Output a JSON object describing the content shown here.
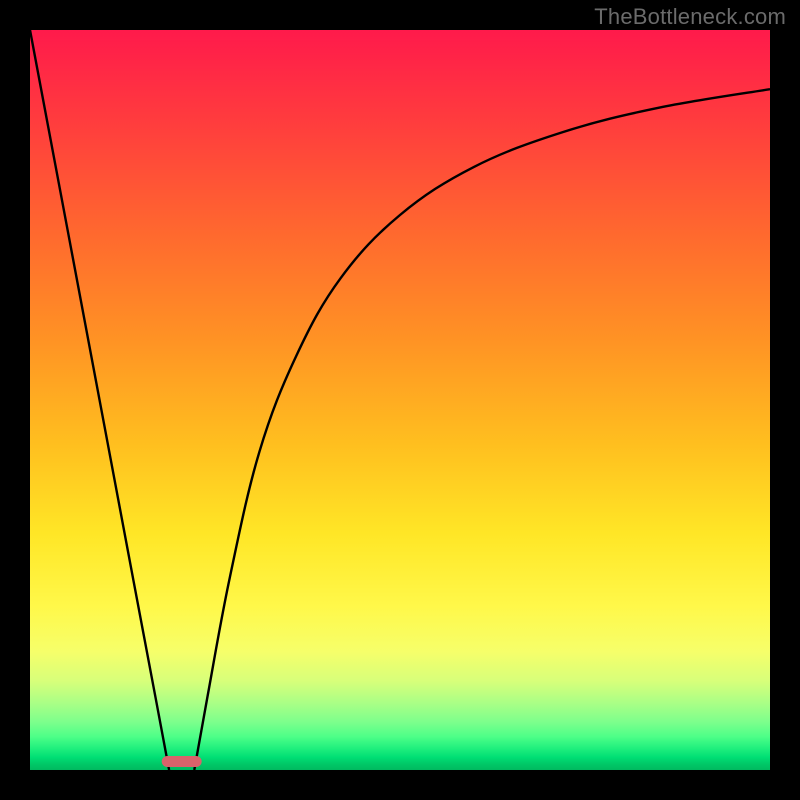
{
  "watermark": "TheBottleneck.com",
  "chart_data": {
    "type": "line",
    "title": "",
    "xlabel": "",
    "ylabel": "",
    "xlim": [
      0,
      100
    ],
    "ylim": [
      0,
      100
    ],
    "grid": false,
    "legend": false,
    "gradient_stops": [
      {
        "pos": 0,
        "color": "#ff1a4b"
      },
      {
        "pos": 12,
        "color": "#ff3b3e"
      },
      {
        "pos": 28,
        "color": "#ff6a2e"
      },
      {
        "pos": 42,
        "color": "#ff9324"
      },
      {
        "pos": 56,
        "color": "#ffbf1f"
      },
      {
        "pos": 68,
        "color": "#ffe626"
      },
      {
        "pos": 78,
        "color": "#fff84a"
      },
      {
        "pos": 84,
        "color": "#f6ff6a"
      },
      {
        "pos": 88,
        "color": "#d7ff7a"
      },
      {
        "pos": 91,
        "color": "#a9ff86"
      },
      {
        "pos": 93.5,
        "color": "#7dff8c"
      },
      {
        "pos": 95.5,
        "color": "#4dff88"
      },
      {
        "pos": 97,
        "color": "#22f07e"
      },
      {
        "pos": 98.3,
        "color": "#00de74"
      },
      {
        "pos": 99.2,
        "color": "#00c867"
      },
      {
        "pos": 100,
        "color": "#00b95f"
      }
    ],
    "series": [
      {
        "name": "bottleneck-curve-left",
        "stroke": "#000000",
        "x": [
          0,
          5,
          10,
          14,
          17,
          18.8
        ],
        "y": [
          100,
          73.4,
          46.8,
          25.5,
          9.6,
          0
        ]
      },
      {
        "name": "bottleneck-curve-right",
        "stroke": "#000000",
        "x": [
          22.2,
          24,
          27,
          31,
          36,
          42,
          50,
          60,
          72,
          85,
          100
        ],
        "y": [
          0,
          10,
          26,
          43,
          56,
          66.5,
          75,
          81.5,
          86.2,
          89.5,
          92
        ]
      }
    ],
    "marker": {
      "name": "optimal-range-marker",
      "color": "#d9636b",
      "x_center": 20.5,
      "y": 0.4,
      "width_x": 5.4,
      "height_y": 1.5
    }
  }
}
